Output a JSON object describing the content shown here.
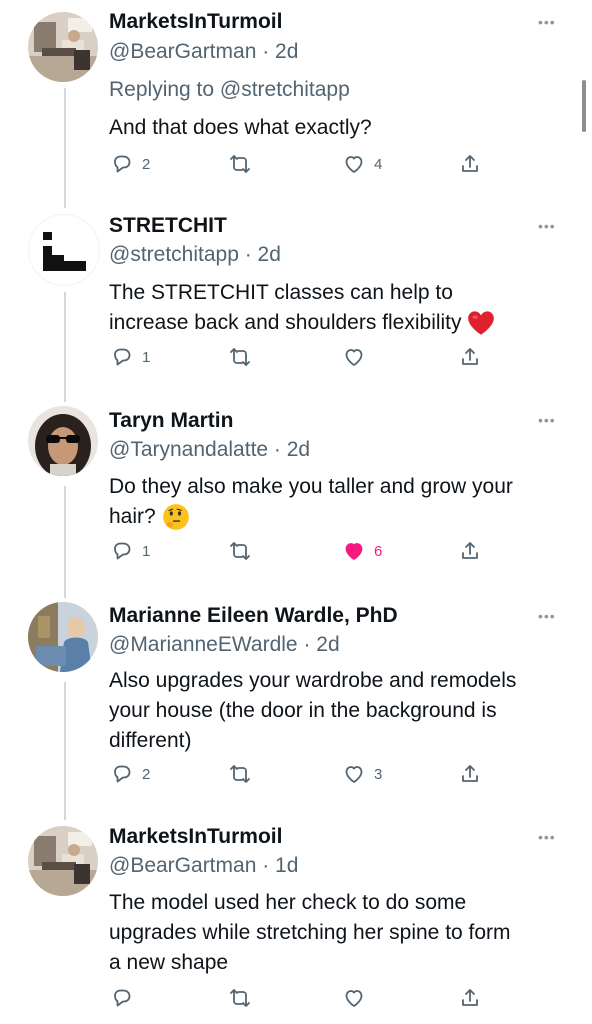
{
  "tweets": [
    {
      "name": "MarketsInTurmoil",
      "handle": "@BearGartman · 2d",
      "reply_to": "Replying to @stretchitapp",
      "text": "And that does what exactly?",
      "replies": "2",
      "retweets": "",
      "likes": "4",
      "liked": false
    },
    {
      "name": "STRETCHIT",
      "handle": "@stretchitapp · 2d",
      "text_line1": "The STRETCHIT classes can help to",
      "text_line2": "increase back and shoulders flexibility",
      "replies": "1",
      "retweets": "",
      "likes": "",
      "liked": false
    },
    {
      "name": "Taryn Martin",
      "handle": "@Tarynandalatte · 2d",
      "text_line1": "Do they also make you taller and grow your",
      "text_line2": "hair?",
      "replies": "1",
      "retweets": "",
      "likes": "6",
      "liked": true
    },
    {
      "name": "Marianne Eileen Wardle, PhD",
      "handle": "@MarianneEWardle · 2d",
      "text_line1": "Also upgrades your wardrobe and remodels",
      "text_line2": "your house (the door in the background is",
      "text_line3": "different)",
      "replies": "2",
      "retweets": "",
      "likes": "3",
      "liked": false
    },
    {
      "name": "MarketsInTurmoil",
      "handle": "@BearGartman · 1d",
      "text_line1": "The model used her check to do some",
      "text_line2": "upgrades while stretching her spine to form",
      "text_line3": "a new shape",
      "replies": "",
      "retweets": "",
      "likes": "",
      "liked": false
    }
  ],
  "more_glyph": "•••",
  "icons": [
    "reply-icon",
    "retweet-icon",
    "like-icon",
    "share-icon",
    "more-icon"
  ],
  "colors": {
    "like_active": "#f91880",
    "secondary_text": "#536471",
    "thread_line": "#cfd9de"
  }
}
